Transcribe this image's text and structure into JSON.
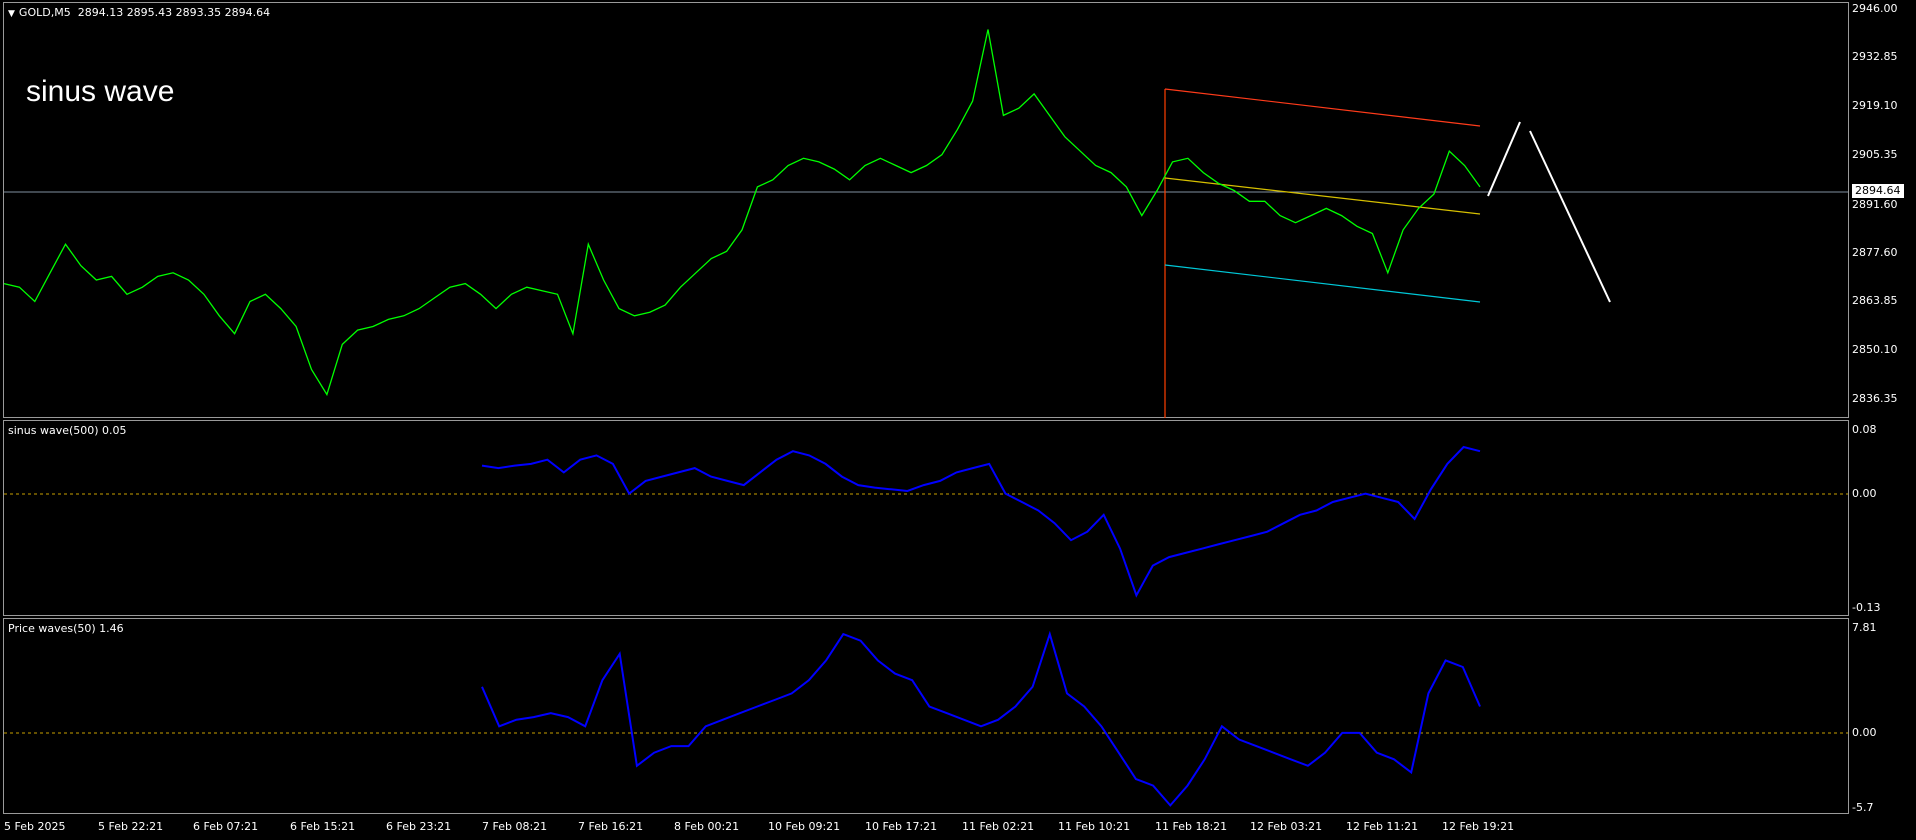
{
  "chart_header": {
    "symbol": "GOLD,M5",
    "ohlc": "2894.13 2895.43 2893.35 2894.64"
  },
  "title_text": "sinus wave",
  "current_price": "2894.64",
  "price_axis": [
    "2946.00",
    "2932.85",
    "2919.10",
    "2905.35",
    "2891.60",
    "2877.60",
    "2863.85",
    "2850.10",
    "2836.35"
  ],
  "indicator1": {
    "label": "sinus wave(500) 0.05",
    "axis": [
      "0.08",
      "0.00",
      "-0.13"
    ]
  },
  "indicator2": {
    "label": "Price waves(50) 1.46",
    "axis": [
      "7.81",
      "0.00",
      "-5.7"
    ]
  },
  "time_axis": [
    "5 Feb 2025",
    "5 Feb 22:21",
    "6 Feb 07:21",
    "6 Feb 15:21",
    "6 Feb 23:21",
    "7 Feb 08:21",
    "7 Feb 16:21",
    "8 Feb 00:21",
    "10 Feb 09:21",
    "10 Feb 17:21",
    "11 Feb 02:21",
    "11 Feb 10:21",
    "11 Feb 18:21",
    "12 Feb 03:21",
    "12 Feb 11:21",
    "12 Feb 19:21"
  ],
  "colors": {
    "price_line": "#00ff00",
    "indicator_line": "#0000ff",
    "zero_line": "#c8a000",
    "channel_top": "#ff3b1a",
    "channel_mid": "#d6c000",
    "channel_bottom": "#00c8d8",
    "projection": "#ffffff",
    "vertical_marker": "#ff4000"
  },
  "chart_data": [
    {
      "type": "line",
      "series": [
        {
          "name": "GOLD,M5",
          "values": [
            2869,
            2868,
            2864,
            2872,
            2880,
            2874,
            2870,
            2871,
            2866,
            2868,
            2871,
            2872,
            2870,
            2866,
            2860,
            2855,
            2864,
            2866,
            2862,
            2857,
            2845,
            2838,
            2852,
            2856,
            2857,
            2859,
            2860,
            2862,
            2865,
            2868,
            2869,
            2866,
            2862,
            2866,
            2868,
            2867,
            2866,
            2855,
            2880,
            2870,
            2862,
            2860,
            2861,
            2863,
            2868,
            2872,
            2876,
            2878,
            2884,
            2896,
            2898,
            2902,
            2904,
            2903,
            2901,
            2898,
            2902,
            2904,
            2902,
            2900,
            2902,
            2905,
            2912,
            2920,
            2940,
            2916,
            2918,
            2922,
            2916,
            2910,
            2906,
            2902,
            2900,
            2896,
            2888,
            2895,
            2903,
            2904,
            2900,
            2897,
            2895,
            2892,
            2892,
            2888,
            2886,
            2888,
            2890,
            2888,
            2885,
            2883,
            2872,
            2884,
            2890,
            2894,
            2906,
            2902,
            2896
          ]
        }
      ],
      "ylim": [
        2832,
        2946
      ]
    },
    {
      "type": "line",
      "series": [
        {
          "name": "sinus wave(500)",
          "values": [
            0.038,
            0.035,
            0.038,
            0.04,
            0.045,
            0.03,
            0.045,
            0.05,
            0.04,
            0.005,
            0.02,
            0.025,
            0.03,
            0.035,
            0.025,
            0.02,
            0.015,
            0.03,
            0.045,
            0.055,
            0.05,
            0.04,
            0.025,
            0.015,
            0.012,
            0.01,
            0.008,
            0.015,
            0.02,
            0.03,
            0.035,
            0.04,
            0.005,
            -0.005,
            -0.015,
            -0.03,
            -0.05,
            -0.04,
            -0.02,
            -0.06,
            -0.115,
            -0.08,
            -0.07,
            -0.065,
            -0.06,
            -0.055,
            -0.05,
            -0.045,
            -0.04,
            -0.03,
            -0.02,
            -0.015,
            -0.005,
            0.0,
            0.005,
            0.0,
            -0.005,
            -0.025,
            0.01,
            0.04,
            0.06,
            0.055
          ]
        }
      ],
      "ylim": [
        -0.13,
        0.08
      ]
    },
    {
      "type": "line",
      "series": [
        {
          "name": "Price waves(50)",
          "values": [
            3.5,
            0.5,
            1.0,
            1.2,
            1.5,
            1.2,
            0.5,
            4.0,
            6.0,
            -2.5,
            -1.5,
            -1.0,
            -1.0,
            0.5,
            1.0,
            1.5,
            2.0,
            2.5,
            3.0,
            4.0,
            5.5,
            7.5,
            7.0,
            5.5,
            4.5,
            4.0,
            2.0,
            1.5,
            1.0,
            0.5,
            1.0,
            2.0,
            3.5,
            7.5,
            3.0,
            2.0,
            0.5,
            -1.5,
            -3.5,
            -4.0,
            -5.5,
            -4.0,
            -2.0,
            0.5,
            -0.5,
            -1.0,
            -1.5,
            -2.0,
            -2.5,
            -1.5,
            0.0,
            0.0,
            -1.5,
            -2.0,
            -3.0,
            3.0,
            5.5,
            5.0,
            2.0
          ]
        }
      ],
      "ylim": [
        -5.7,
        7.81
      ]
    }
  ]
}
